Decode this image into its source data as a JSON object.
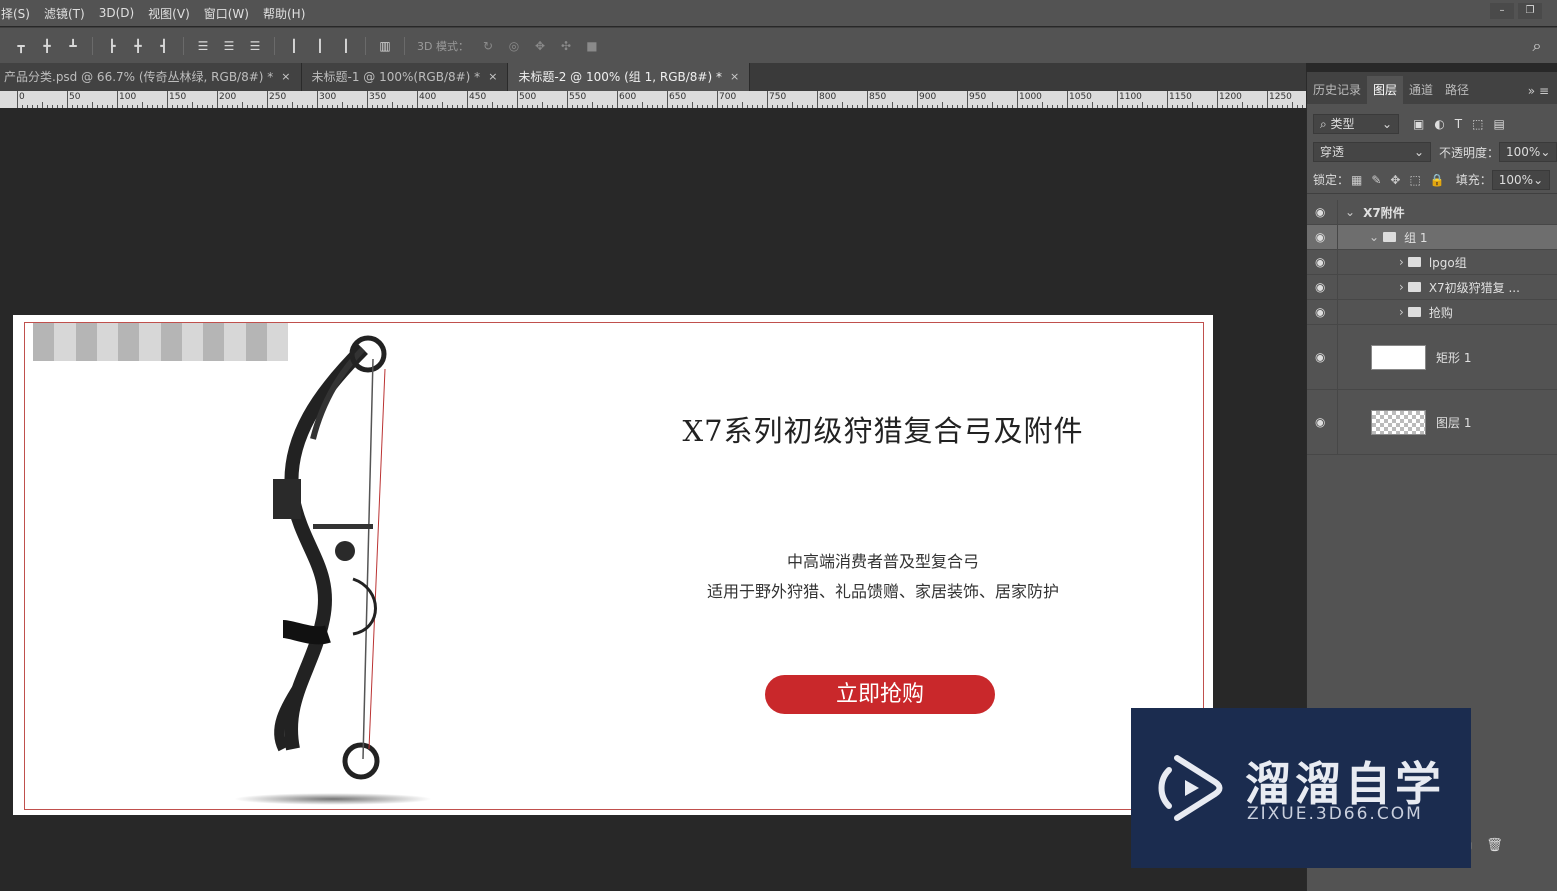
{
  "menubar": {
    "items": [
      "择(S)",
      "滤镜(T)",
      "3D(D)",
      "视图(V)",
      "窗口(W)",
      "帮助(H)"
    ],
    "minimize": "–",
    "restore": "❐"
  },
  "options_bar": {
    "mode_3d_label": "3D 模式："
  },
  "tabs": [
    {
      "label": "产品分类.psd @ 66.7% (传奇丛林绿, RGB/8#) *",
      "close": "×"
    },
    {
      "label": "未标题-1 @ 100%(RGB/8#) *",
      "close": "×"
    },
    {
      "label": "未标题-2 @ 100% (组 1, RGB/8#) *",
      "close": "×"
    }
  ],
  "ruler": {
    "labels": [
      "0",
      "50",
      "100",
      "150",
      "200",
      "250",
      "300",
      "350",
      "400",
      "450",
      "500",
      "550",
      "600",
      "650",
      "700",
      "750",
      "800",
      "850",
      "900",
      "950",
      "1000",
      "1050",
      "1100",
      "1150",
      "1200",
      "1250"
    ]
  },
  "banner": {
    "title": "X7系列初级狩猎复合弓及附件",
    "line1": "中高端消费者普及型复合弓",
    "line2": "适用于野外狩猎、礼品馈赠、家居装饰、居家防护",
    "button": "立即抢购",
    "accent_color": "#c9282b"
  },
  "panel": {
    "tabs": [
      "历史记录",
      "图层",
      "通道",
      "路径"
    ],
    "filter_type": "类型",
    "blend_mode": "穿透",
    "opacity_label": "不透明度：",
    "opacity_value": "100%",
    "lock_label": "锁定：",
    "fill_label": "填充：",
    "fill_value": "100%",
    "layers": [
      {
        "name": "X7附件"
      },
      {
        "name": "组 1"
      },
      {
        "name": "lpgo组"
      },
      {
        "name": "X7初级狩猎复 ..."
      },
      {
        "name": "抢购"
      },
      {
        "name": "矩形 1"
      },
      {
        "name": "图层 1"
      }
    ]
  },
  "watermark": {
    "text": "溜溜自学",
    "url": "ZIXUE.3D66.COM"
  }
}
